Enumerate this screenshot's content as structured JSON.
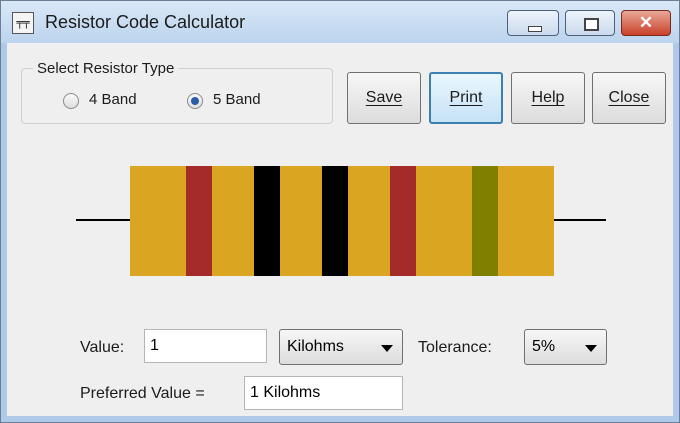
{
  "window": {
    "title": "Resistor Code Calculator",
    "icon": "resistor-app-icon",
    "icon_glyph": "╤╤"
  },
  "titlebar_buttons": {
    "minimize": "minimize-icon",
    "maximize": "maximize-icon",
    "close": "✕"
  },
  "resistor_type": {
    "label": "Select Resistor Type",
    "options": [
      {
        "label": "4 Band",
        "selected": false
      },
      {
        "label": "5 Band",
        "selected": true
      }
    ]
  },
  "buttons": {
    "save": "Save",
    "print": "Print",
    "help": "Help",
    "close": "Close"
  },
  "resistor": {
    "body_color": "#daa520",
    "bands": [
      {
        "name": "band-1",
        "color": "#a52a2a"
      },
      {
        "name": "band-2",
        "color": "#000000"
      },
      {
        "name": "band-3",
        "color": "#000000"
      },
      {
        "name": "band-4",
        "color": "#a52a2a"
      },
      {
        "name": "tolerance-band",
        "color": "#808000"
      }
    ]
  },
  "value": {
    "label": "Value:",
    "input": "1"
  },
  "unit": {
    "selected": "Kilohms"
  },
  "tolerance": {
    "label": "Tolerance:",
    "selected": "5%"
  },
  "preferred": {
    "label": "Preferred Value =",
    "value": "1 Kilohms"
  }
}
